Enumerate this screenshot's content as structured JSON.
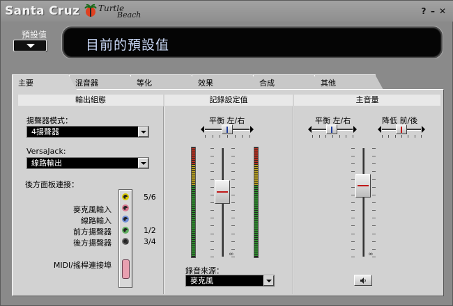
{
  "app": {
    "title": "Santa Cruz",
    "logo_text_line1": "Turtle",
    "logo_text_line2": "Beach",
    "help_label": "?",
    "minimize_label": "–",
    "close_label": "✕"
  },
  "preset": {
    "label": "預設值",
    "current": "目前的預設值"
  },
  "tabs": [
    {
      "label": "主要",
      "active": true
    },
    {
      "label": "混音器",
      "active": false
    },
    {
      "label": "等化",
      "active": false
    },
    {
      "label": "效果",
      "active": false
    },
    {
      "label": "合成",
      "active": false
    },
    {
      "label": "其他",
      "active": false
    }
  ],
  "output": {
    "header": "輸出組態",
    "speaker_mode_label": "揚聲器模式：",
    "speaker_mode_value": "4揚聲器",
    "versajack_label": "VersaJack:",
    "versajack_value": "線路輸出",
    "rear_panel_label": "後方面板連接：",
    "jacks": [
      {
        "label": "",
        "channel": "5/6",
        "color": "yellow"
      },
      {
        "label": "麥克風輸入",
        "channel": "",
        "color": "pink"
      },
      {
        "label": "線路輸入",
        "channel": "",
        "color": "blue"
      },
      {
        "label": "前方揚聲器",
        "channel": "1/2",
        "color": "green"
      },
      {
        "label": "後方揚聲器",
        "channel": "3/4",
        "color": "black"
      }
    ],
    "midi_label": "MIDI/搖桿連接埠"
  },
  "record": {
    "header": "記錄設定值",
    "balance_label": "平衡 左/右",
    "source_label": "錄音來源：",
    "source_value": "麥克風",
    "volume_level": 0.62,
    "balance_position": 0.5,
    "inf_label": "∞"
  },
  "master": {
    "header": "主音量",
    "balance_label": "平衡 左/右",
    "fader_label": "降低 前/後",
    "volume_level": 0.7,
    "balance_position": 0.5,
    "fader_position": 0.5,
    "inf_label": "∞"
  },
  "colors": {
    "preset_text": "#c8d6f4",
    "meter_green": "#2e8f2e",
    "meter_yellow": "#b8a020",
    "meter_red": "#b83020"
  }
}
